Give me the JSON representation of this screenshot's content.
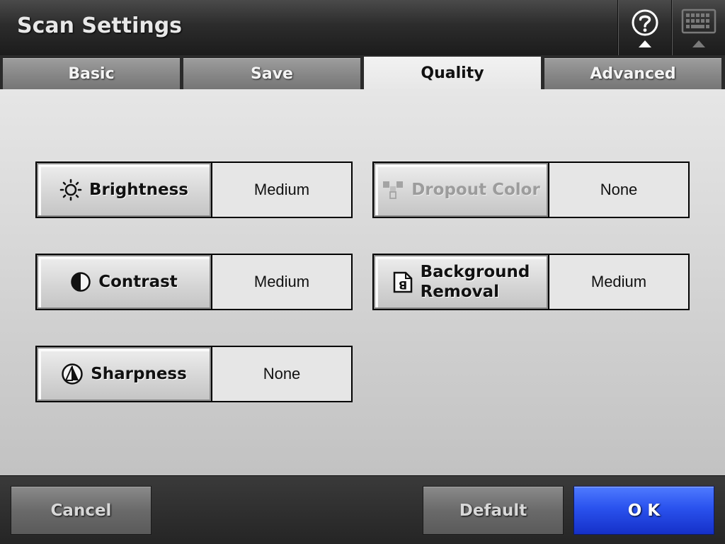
{
  "window": {
    "title": "Scan Settings"
  },
  "header_icons": {
    "help": "help-icon",
    "keyboard": "keyboard-icon"
  },
  "tabs": [
    {
      "label": "Basic",
      "active": false
    },
    {
      "label": "Save",
      "active": false
    },
    {
      "label": "Quality",
      "active": true
    },
    {
      "label": "Advanced",
      "active": false
    }
  ],
  "settings": {
    "brightness": {
      "label": "Brightness",
      "value": "Medium",
      "icon": "sun-icon",
      "enabled": true
    },
    "contrast": {
      "label": "Contrast",
      "value": "Medium",
      "icon": "contrast-icon",
      "enabled": true
    },
    "sharpness": {
      "label": "Sharpness",
      "value": "None",
      "icon": "sharpness-icon",
      "enabled": true
    },
    "dropout_color": {
      "label": "Dropout Color",
      "value": "None",
      "icon": "dropout-color-icon",
      "enabled": false
    },
    "background_removal": {
      "label_line1": "Background",
      "label_line2": "Removal",
      "value": "Medium",
      "icon": "background-removal-icon",
      "enabled": true
    }
  },
  "footer": {
    "cancel_label": "Cancel",
    "default_label": "Default",
    "ok_label": "O K"
  },
  "colors": {
    "ok_button": "#2a52ee",
    "active_tab": "#eeeeee",
    "inactive_tab": "#888888"
  }
}
